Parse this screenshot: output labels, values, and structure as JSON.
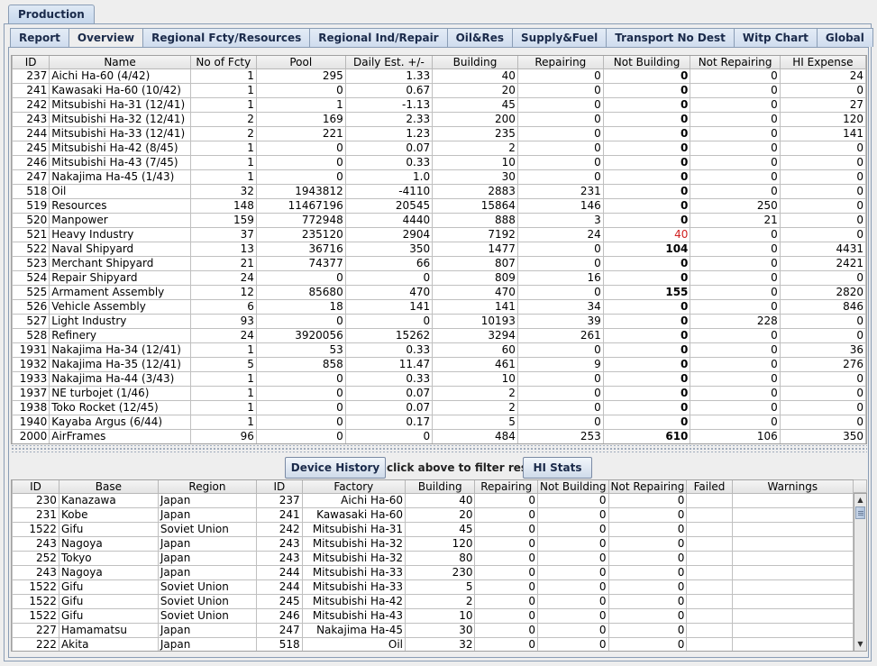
{
  "outer_tab": "Production",
  "tabs": [
    "Report",
    "Overview",
    "Regional Fcty/Resources",
    "Regional Ind/Repair",
    "Oil&Res",
    "Supply&Fuel",
    "Transport No Dest",
    "Witp Chart",
    "Global"
  ],
  "active_tab": "Overview",
  "top_table": {
    "columns": [
      "ID",
      "Name",
      "No of Fcty",
      "Pool",
      "Daily Est. +/-",
      "Building",
      "Repairing",
      "Not Building",
      "Not Repairing",
      "HI Expense"
    ],
    "rows": [
      [
        "237",
        "Aichi Ha-60  (4/42)",
        "1",
        "295",
        "1.33",
        "40",
        "0",
        "0",
        "0",
        "24"
      ],
      [
        "241",
        "Kawasaki Ha-60  (10/42)",
        "1",
        "0",
        "0.67",
        "20",
        "0",
        "0",
        "0",
        "0"
      ],
      [
        "242",
        "Mitsubishi Ha-31  (12/41)",
        "1",
        "1",
        "-1.13",
        "45",
        "0",
        "0",
        "0",
        "27"
      ],
      [
        "243",
        "Mitsubishi Ha-32 (12/41)",
        "2",
        "169",
        "2.33",
        "200",
        "0",
        "0",
        "0",
        "120"
      ],
      [
        "244",
        "Mitsubishi Ha-33 (12/41)",
        "2",
        "221",
        "1.23",
        "235",
        "0",
        "0",
        "0",
        "141"
      ],
      [
        "245",
        "Mitsubishi Ha-42 (8/45)",
        "1",
        "0",
        "0.07",
        "2",
        "0",
        "0",
        "0",
        "0"
      ],
      [
        "246",
        "Mitsubishi Ha-43 (7/45)",
        "1",
        "0",
        "0.33",
        "10",
        "0",
        "0",
        "0",
        "0"
      ],
      [
        "247",
        "Nakajima Ha-45 (1/43)",
        "1",
        "0",
        "1.0",
        "30",
        "0",
        "0",
        "0",
        "0"
      ],
      [
        "518",
        "Oil",
        "32",
        "1943812",
        "-4110",
        "2883",
        "231",
        "0",
        "0",
        "0"
      ],
      [
        "519",
        "Resources",
        "148",
        "11467196",
        "20545",
        "15864",
        "146",
        "0",
        "250",
        "0"
      ],
      [
        "520",
        "Manpower",
        "159",
        "772948",
        "4440",
        "888",
        "3",
        "0",
        "21",
        "0"
      ],
      [
        "521",
        "Heavy Industry",
        "37",
        "235120",
        "2904",
        "7192",
        "24",
        "40",
        "0",
        "0"
      ],
      [
        "522",
        "Naval Shipyard",
        "13",
        "36716",
        "350",
        "1477",
        "0",
        "104",
        "0",
        "4431"
      ],
      [
        "523",
        "Merchant Shipyard",
        "21",
        "74377",
        "66",
        "807",
        "0",
        "0",
        "0",
        "2421"
      ],
      [
        "524",
        "Repair Shipyard",
        "24",
        "0",
        "0",
        "809",
        "16",
        "0",
        "0",
        "0"
      ],
      [
        "525",
        "Armament Assembly",
        "12",
        "85680",
        "470",
        "470",
        "0",
        "155",
        "0",
        "2820"
      ],
      [
        "526",
        "Vehicle Assembly",
        "6",
        "18",
        "141",
        "141",
        "34",
        "0",
        "0",
        "846"
      ],
      [
        "527",
        "Light Industry",
        "93",
        "0",
        "0",
        "10193",
        "39",
        "0",
        "228",
        "0"
      ],
      [
        "528",
        "Refinery",
        "24",
        "3920056",
        "15262",
        "3294",
        "261",
        "0",
        "0",
        "0"
      ],
      [
        "1931",
        "Nakajima Ha-34  (12/41)",
        "1",
        "53",
        "0.33",
        "60",
        "0",
        "0",
        "0",
        "36"
      ],
      [
        "1932",
        "Nakajima Ha-35  (12/41)",
        "5",
        "858",
        "11.47",
        "461",
        "9",
        "0",
        "0",
        "276"
      ],
      [
        "1933",
        "Nakajima Ha-44 (3/43)",
        "1",
        "0",
        "0.33",
        "10",
        "0",
        "0",
        "0",
        "0"
      ],
      [
        "1937",
        "NE turbojet (1/46)",
        "1",
        "0",
        "0.07",
        "2",
        "0",
        "0",
        "0",
        "0"
      ],
      [
        "1938",
        "Toko Rocket  (12/45)",
        "1",
        "0",
        "0.07",
        "2",
        "0",
        "0",
        "0",
        "0"
      ],
      [
        "1940",
        "Kayaba Argus (6/44)",
        "1",
        "0",
        "0.17",
        "5",
        "0",
        "0",
        "0",
        "0"
      ],
      [
        "2000",
        "AirFrames",
        "96",
        "0",
        "0",
        "484",
        "253",
        "610",
        "106",
        "350"
      ]
    ]
  },
  "controls": {
    "device_history": "Device History",
    "hint": "click above to filter results",
    "hi_stats": "HI Stats"
  },
  "bottom_table": {
    "columns": [
      "ID",
      "Base",
      "Region",
      "ID",
      "Factory",
      "Building",
      "Repairing",
      "Not Building",
      "Not Repairing",
      "Failed",
      "Warnings"
    ],
    "rows": [
      [
        "230",
        "Kanazawa",
        "Japan",
        "237",
        "Aichi Ha-60",
        "40",
        "0",
        "0",
        "0",
        "",
        ""
      ],
      [
        "231",
        "Kobe",
        "Japan",
        "241",
        "Kawasaki Ha-60",
        "20",
        "0",
        "0",
        "0",
        "",
        ""
      ],
      [
        "1522",
        "Gifu",
        "Soviet Union",
        "242",
        "Mitsubishi Ha-31",
        "45",
        "0",
        "0",
        "0",
        "",
        ""
      ],
      [
        "243",
        "Nagoya",
        "Japan",
        "243",
        "Mitsubishi Ha-32",
        "120",
        "0",
        "0",
        "0",
        "",
        ""
      ],
      [
        "252",
        "Tokyo",
        "Japan",
        "243",
        "Mitsubishi Ha-32",
        "80",
        "0",
        "0",
        "0",
        "",
        ""
      ],
      [
        "243",
        "Nagoya",
        "Japan",
        "244",
        "Mitsubishi Ha-33",
        "230",
        "0",
        "0",
        "0",
        "",
        ""
      ],
      [
        "1522",
        "Gifu",
        "Soviet Union",
        "244",
        "Mitsubishi Ha-33",
        "5",
        "0",
        "0",
        "0",
        "",
        ""
      ],
      [
        "1522",
        "Gifu",
        "Soviet Union",
        "245",
        "Mitsubishi Ha-42",
        "2",
        "0",
        "0",
        "0",
        "",
        ""
      ],
      [
        "1522",
        "Gifu",
        "Soviet Union",
        "246",
        "Mitsubishi Ha-43",
        "10",
        "0",
        "0",
        "0",
        "",
        ""
      ],
      [
        "227",
        "Hamamatsu",
        "Japan",
        "247",
        "Nakajima Ha-45",
        "30",
        "0",
        "0",
        "0",
        "",
        ""
      ],
      [
        "222",
        "Akita",
        "Japan",
        "518",
        "Oil",
        "32",
        "0",
        "0",
        "0",
        "",
        ""
      ]
    ]
  },
  "colors": {
    "warning_value": "#d02020",
    "tab_border": "#8a9db5"
  },
  "icons": {
    "scroll_up": "triangle-up-icon",
    "scroll_down": "triangle-down-icon"
  }
}
